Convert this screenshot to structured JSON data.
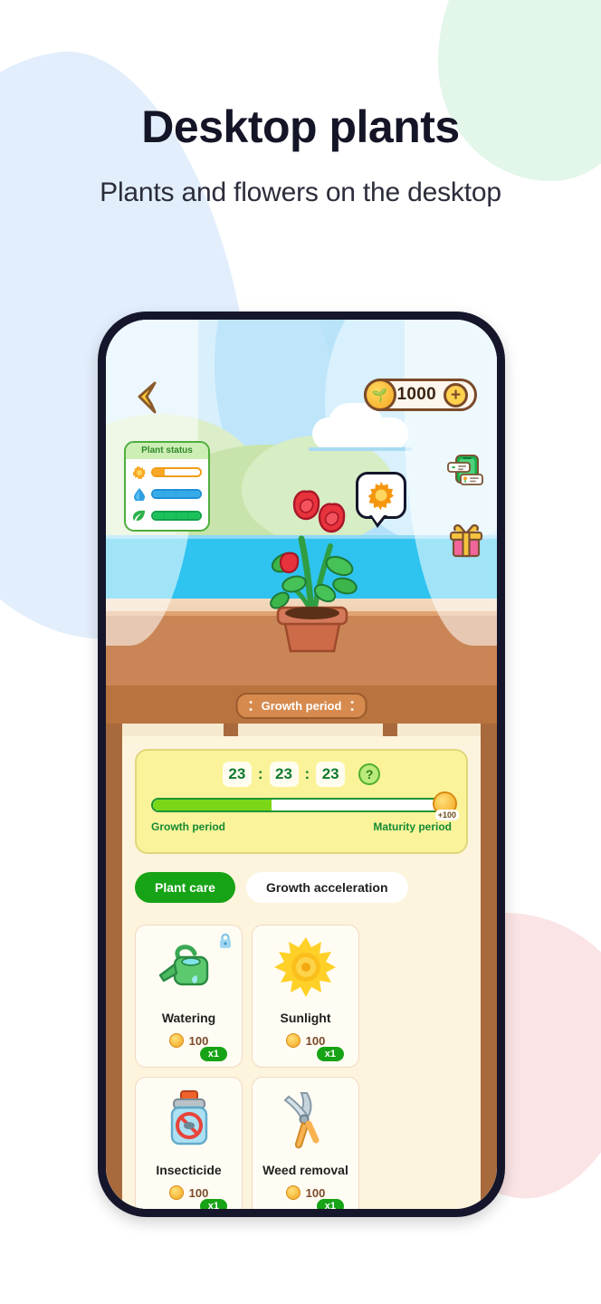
{
  "header": {
    "title": "Desktop plants",
    "subtitle": "Plants and flowers on the desktop"
  },
  "colors": {
    "accent_green": "#17a316",
    "coin_gold": "#f5a623",
    "sky_blue": "#bfe6fb",
    "sea_blue": "#2fc3f0",
    "shelf_brown": "#c98555",
    "panel_cream": "#fdf4dd",
    "timer_yellow": "#fbf39a",
    "blob_blue": "#e3eefc",
    "blob_green": "#e2f6ea",
    "blob_pink": "#fbe4e6"
  },
  "scene": {
    "back_button": "back-arrow-icon",
    "currency": {
      "icon": "coin-icon",
      "amount": "1000",
      "add_label": "+"
    },
    "status_card": {
      "title": "Plant status",
      "meters": [
        {
          "icon": "sun-icon",
          "level": 25,
          "color": "#f9a825"
        },
        {
          "icon": "water-drop-icon",
          "level": 100,
          "color": "#35abe8"
        },
        {
          "icon": "leaf-icon",
          "level": 100,
          "color": "#1bc25c"
        }
      ]
    },
    "side_icons": [
      {
        "name": "tasks-icon"
      },
      {
        "name": "gift-icon"
      }
    ],
    "bubble": {
      "icon": "sun-icon"
    },
    "plant": {
      "name": "rose-plant",
      "pot": "terracotta-pot"
    },
    "banner_label": "Growth period"
  },
  "growth": {
    "timer": {
      "hours": "23",
      "minutes": "23",
      "seconds": "23",
      "separator": ":"
    },
    "help_label": "?",
    "progress_percent": 40,
    "reward": "+100",
    "left_label": "Growth period",
    "right_label": "Maturity period"
  },
  "tabs": [
    {
      "label": "Plant care",
      "active": true
    },
    {
      "label": "Growth acceleration",
      "active": false
    }
  ],
  "items": [
    {
      "name": "Watering",
      "qty": "x1",
      "price": "100",
      "icon": "watering-can-icon",
      "locked": true
    },
    {
      "name": "Sunlight",
      "qty": "x1",
      "price": "100",
      "icon": "sun-icon",
      "locked": false
    },
    {
      "name": "Insecticide",
      "qty": "x1",
      "price": "100",
      "icon": "insecticide-bottle-icon",
      "locked": false
    },
    {
      "name": "Weed removal",
      "qty": "x1",
      "price": "100",
      "icon": "pruning-shears-icon",
      "locked": false
    }
  ]
}
